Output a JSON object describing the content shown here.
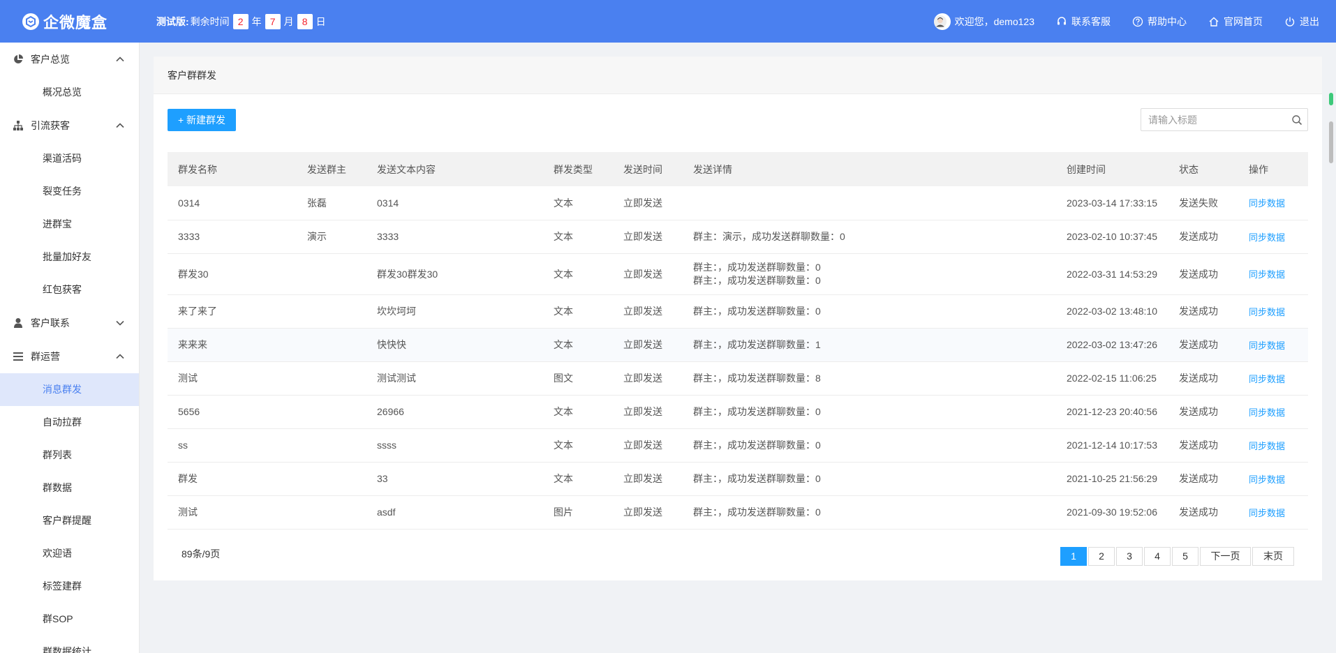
{
  "header": {
    "brand": "企微魔盒",
    "trial_label": "测试版:",
    "trial_prefix": "剩余时间",
    "years": "2",
    "year_unit": "年",
    "months": "7",
    "month_unit": "月",
    "days": "8",
    "day_unit": "日",
    "welcome": "欢迎您，demo123",
    "service": "联系客服",
    "help": "帮助中心",
    "home": "官网首页",
    "logout": "退出",
    "colors": {
      "bar": "#4a80f0",
      "accent": "#1e9fff",
      "countdown": "#f5222d"
    }
  },
  "sidebar": {
    "groups": [
      {
        "label": "客户总览",
        "icon": "pie-chart-icon",
        "expanded": true,
        "items": [
          "概况总览"
        ]
      },
      {
        "label": "引流获客",
        "icon": "org-tree-icon",
        "expanded": true,
        "items": [
          "渠道活码",
          "裂变任务",
          "进群宝",
          "批量加好友",
          "红包获客"
        ]
      },
      {
        "label": "客户联系",
        "icon": "user-icon",
        "expanded": false,
        "items": []
      },
      {
        "label": "群运营",
        "icon": "menu-lines-icon",
        "expanded": true,
        "items": [
          "消息群发",
          "自动拉群",
          "群列表",
          "群数据",
          "客户群提醒",
          "欢迎语",
          "标签建群",
          "群SOP",
          "群数据统计"
        ]
      }
    ],
    "active_item": "消息群发"
  },
  "panel": {
    "title": "客户群群发",
    "new_button": "+ 新建群发",
    "search_placeholder": "请输入标题"
  },
  "table": {
    "columns": [
      "群发名称",
      "发送群主",
      "发送文本内容",
      "群发类型",
      "发送时间",
      "发送详情",
      "创建时间",
      "状态",
      "操作"
    ],
    "rows": [
      {
        "name": "0314",
        "owner": "张磊",
        "content": "0314",
        "type": "文本",
        "send_time": "立即发送",
        "details": [],
        "created": "2023-03-14 17:33:15",
        "status": "发送失败",
        "action": "同步数据"
      },
      {
        "name": "3333",
        "owner": "演示",
        "content": "3333",
        "type": "文本",
        "send_time": "立即发送",
        "details": [
          "群主：演示，成功发送群聊数量：0"
        ],
        "created": "2023-02-10 10:37:45",
        "status": "发送成功",
        "action": "同步数据"
      },
      {
        "name": "群发30",
        "owner": "",
        "content": "群发30群发30",
        "type": "文本",
        "send_time": "立即发送",
        "details": [
          "群主：，成功发送群聊数量：0",
          "群主：，成功发送群聊数量：0"
        ],
        "created": "2022-03-31 14:53:29",
        "status": "发送成功",
        "action": "同步数据"
      },
      {
        "name": "来了来了",
        "owner": "",
        "content": "坎坎坷坷",
        "type": "文本",
        "send_time": "立即发送",
        "details": [
          "群主：，成功发送群聊数量：0"
        ],
        "created": "2022-03-02 13:48:10",
        "status": "发送成功",
        "action": "同步数据"
      },
      {
        "name": "来来来",
        "owner": "",
        "content": "快快快",
        "type": "文本",
        "send_time": "立即发送",
        "details": [
          "群主：，成功发送群聊数量：1"
        ],
        "created": "2022-03-02 13:47:26",
        "status": "发送成功",
        "action": "同步数据"
      },
      {
        "name": "测试",
        "owner": "",
        "content": "测试测试",
        "type": "图文",
        "send_time": "立即发送",
        "details": [
          "群主：，成功发送群聊数量：8"
        ],
        "created": "2022-02-15 11:06:25",
        "status": "发送成功",
        "action": "同步数据"
      },
      {
        "name": "5656",
        "owner": "",
        "content": "26966",
        "type": "文本",
        "send_time": "立即发送",
        "details": [
          "群主：，成功发送群聊数量：0"
        ],
        "created": "2021-12-23 20:40:56",
        "status": "发送成功",
        "action": "同步数据"
      },
      {
        "name": "ss",
        "owner": "",
        "content": "ssss",
        "type": "文本",
        "send_time": "立即发送",
        "details": [
          "群主：，成功发送群聊数量：0"
        ],
        "created": "2021-12-14 10:17:53",
        "status": "发送成功",
        "action": "同步数据"
      },
      {
        "name": "群发",
        "owner": "",
        "content": "33",
        "type": "文本",
        "send_time": "立即发送",
        "details": [
          "群主：，成功发送群聊数量：0"
        ],
        "created": "2021-10-25 21:56:29",
        "status": "发送成功",
        "action": "同步数据"
      },
      {
        "name": "测试",
        "owner": "",
        "content": "asdf",
        "type": "图片",
        "send_time": "立即发送",
        "details": [
          "群主：，成功发送群聊数量：0"
        ],
        "created": "2021-09-30 19:52:06",
        "status": "发送成功",
        "action": "同步数据"
      }
    ]
  },
  "pagination": {
    "summary": "89条/9页",
    "pages": [
      "1",
      "2",
      "3",
      "4",
      "5"
    ],
    "current": "1",
    "next": "下一页",
    "last": "末页"
  }
}
